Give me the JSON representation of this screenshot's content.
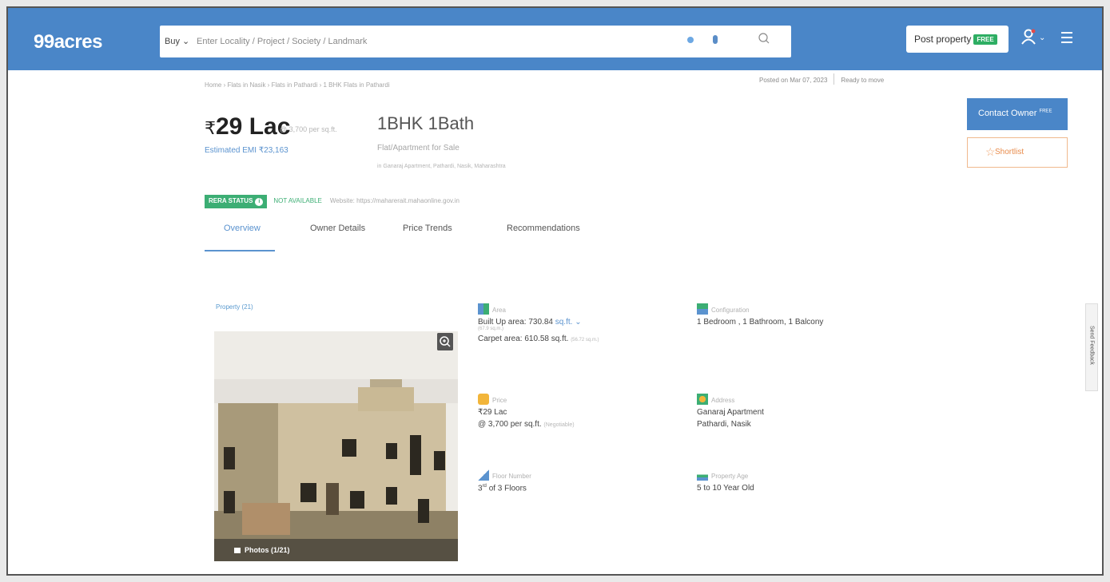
{
  "header": {
    "logo": "99acres",
    "buy_label": "Buy",
    "search_placeholder": "Enter Locality / Project / Society / Landmark",
    "post_property_label": "Post property",
    "free_badge": "FREE"
  },
  "listing": {
    "breadcrumb": "Home › Flats in Nasik › Flats in Pathardi › 1 BHK Flats in Pathardi",
    "posted_on": "Posted on Mar 07, 2023",
    "ready_status": "Ready to move",
    "price": "29 Lac",
    "price_symbol": "₹",
    "price_per_sqft": "@ 3,700 per sq.ft.",
    "config_title": "1BHK 1Bath",
    "emi": "Estimated EMI ₹23,163",
    "property_type": "Flat/Apartment for Sale",
    "address_line": "in Ganaraj Apartment, Pathardi, Nasik, Maharashtra"
  },
  "actions": {
    "contact_owner": "Contact Owner",
    "contact_badge": "FREE",
    "shortlist": "Shortlist"
  },
  "rera": {
    "badge": "RERA STATUS",
    "status": "NOT AVAILABLE",
    "website": "Website: https://maharerait.mahaonline.gov.in"
  },
  "tabs": [
    "Overview",
    "Owner Details",
    "Price Trends",
    "Recommendations"
  ],
  "property": {
    "section_label": "Property (21)",
    "photos_label": "Photos (1/21)"
  },
  "attributes": {
    "area": {
      "label": "Area",
      "built_up": "Built Up area: 730.84",
      "unit": "sq.ft.",
      "built_up_sub": "(67.9 sq.m.)",
      "carpet": "Carpet area: 610.58 sq.ft.",
      "carpet_sub": "(56.72 sq.m.)"
    },
    "configuration": {
      "label": "Configuration",
      "value": "1 Bedroom , 1 Bathroom, 1 Balcony"
    },
    "price": {
      "label": "Price",
      "value": "₹29 Lac",
      "per_sqft": "@ 3,700 per sq.ft.",
      "negotiable": "(Negotiable)"
    },
    "address": {
      "label": "Address",
      "line1": "Ganaraj Apartment",
      "line2": "Pathardi, Nasik"
    },
    "floor": {
      "label": "Floor Number",
      "floor_num": "3",
      "floor_sup": "rd",
      "value": "of 3 Floors"
    },
    "age": {
      "label": "Property Age",
      "value": "5 to 10 Year Old"
    }
  },
  "feedback": "Send Feedback",
  "colors": {
    "brand_blue": "#4a86c8",
    "link_blue": "#5b93cf",
    "rera_green": "#3cae74",
    "shortlist_orange": "#e98c4c"
  }
}
